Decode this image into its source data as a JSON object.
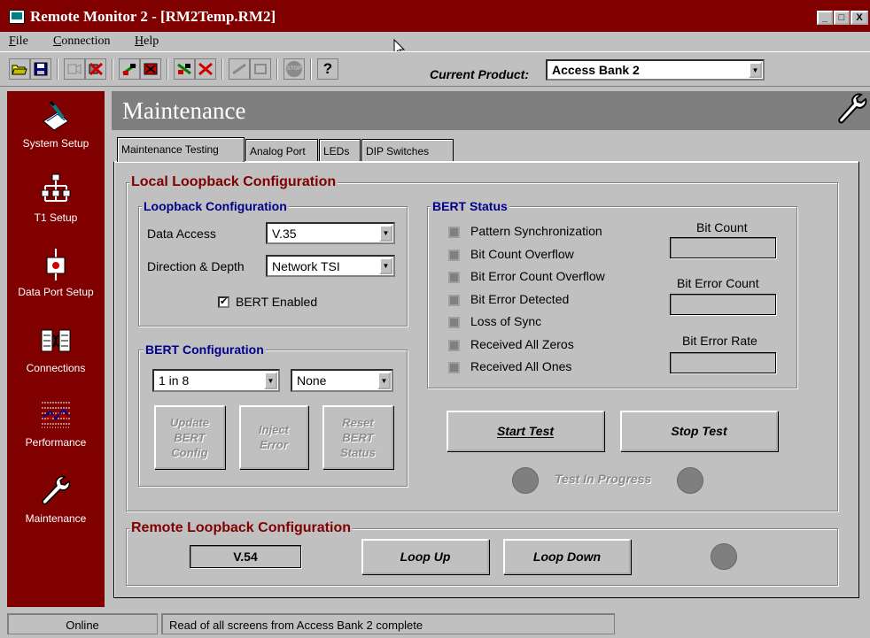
{
  "window": {
    "title": "Remote Monitor 2 - [RM2Temp.RM2]",
    "minimize": "_",
    "maximize": "□",
    "close": "X"
  },
  "menu": [
    "File",
    "Connection",
    "Help"
  ],
  "toolbar": {
    "help_label": "?",
    "stop_label": "STOP",
    "current_product_label": "Current Product:",
    "current_product_value": "Access Bank 2"
  },
  "sidebar": {
    "items": [
      {
        "label": "System Setup",
        "icon": "notepad-icon"
      },
      {
        "label": "T1 Setup",
        "icon": "network-tree-icon"
      },
      {
        "label": "Data Port Setup",
        "icon": "data-port-icon"
      },
      {
        "label": "Connections",
        "icon": "connections-icon"
      },
      {
        "label": "Performance",
        "icon": "performance-chart-icon"
      },
      {
        "label": "Maintenance",
        "icon": "wrench-icon"
      }
    ]
  },
  "header": {
    "title": "Maintenance",
    "icon": "wrench-icon"
  },
  "tabs": [
    {
      "label": "Maintenance Testing",
      "active": true
    },
    {
      "label": "Analog Port",
      "active": false
    },
    {
      "label": "LEDs",
      "active": false
    },
    {
      "label": "DIP Switches",
      "active": false
    }
  ],
  "local": {
    "title": "Local Loopback Configuration",
    "loopback": {
      "title": "Loopback Configuration",
      "data_access_label": "Data Access",
      "data_access_value": "V.35",
      "direction_label": "Direction & Depth",
      "direction_value": "Network TSI",
      "bert_enabled_label": "BERT Enabled",
      "bert_enabled": true,
      "check_mark": "✔"
    },
    "bert_config": {
      "title": "BERT Configuration",
      "pattern_value": "1 in 8",
      "second_value": "None",
      "update_label": "Update\nBERT\nConfig",
      "inject_label": "Inject\nError",
      "reset_label": "Reset\nBERT\nStatus"
    },
    "bert_status": {
      "title": "BERT Status",
      "indicators": [
        "Pattern Synchronization",
        "Bit Count Overflow",
        "Bit Error Count Overflow",
        "Bit Error Detected",
        "Loss of Sync",
        "Received All Zeros",
        "Received All Ones"
      ],
      "bit_count_label": "Bit Count",
      "bit_count_value": "",
      "bit_error_count_label": "Bit Error Count",
      "bit_error_count_value": "",
      "bit_error_rate_label": "Bit Error Rate",
      "bit_error_rate_value": ""
    },
    "start_test_label": "Start Test",
    "stop_test_label": "Stop Test",
    "test_in_progress_label": "Test In Progress"
  },
  "remote": {
    "title": "Remote Loopback Configuration",
    "value": "V.54",
    "loop_up_label": "Loop Up",
    "loop_down_label": "Loop Down"
  },
  "statusbar": {
    "left": "Online",
    "message": "Read of all screens from Access Bank 2 complete"
  },
  "colors": {
    "title_bar": "#800000",
    "sidebar": "#800000",
    "header_bar": "#7f7f7f",
    "group_title_red": "#800000",
    "group_title_blue": "#00008b"
  }
}
